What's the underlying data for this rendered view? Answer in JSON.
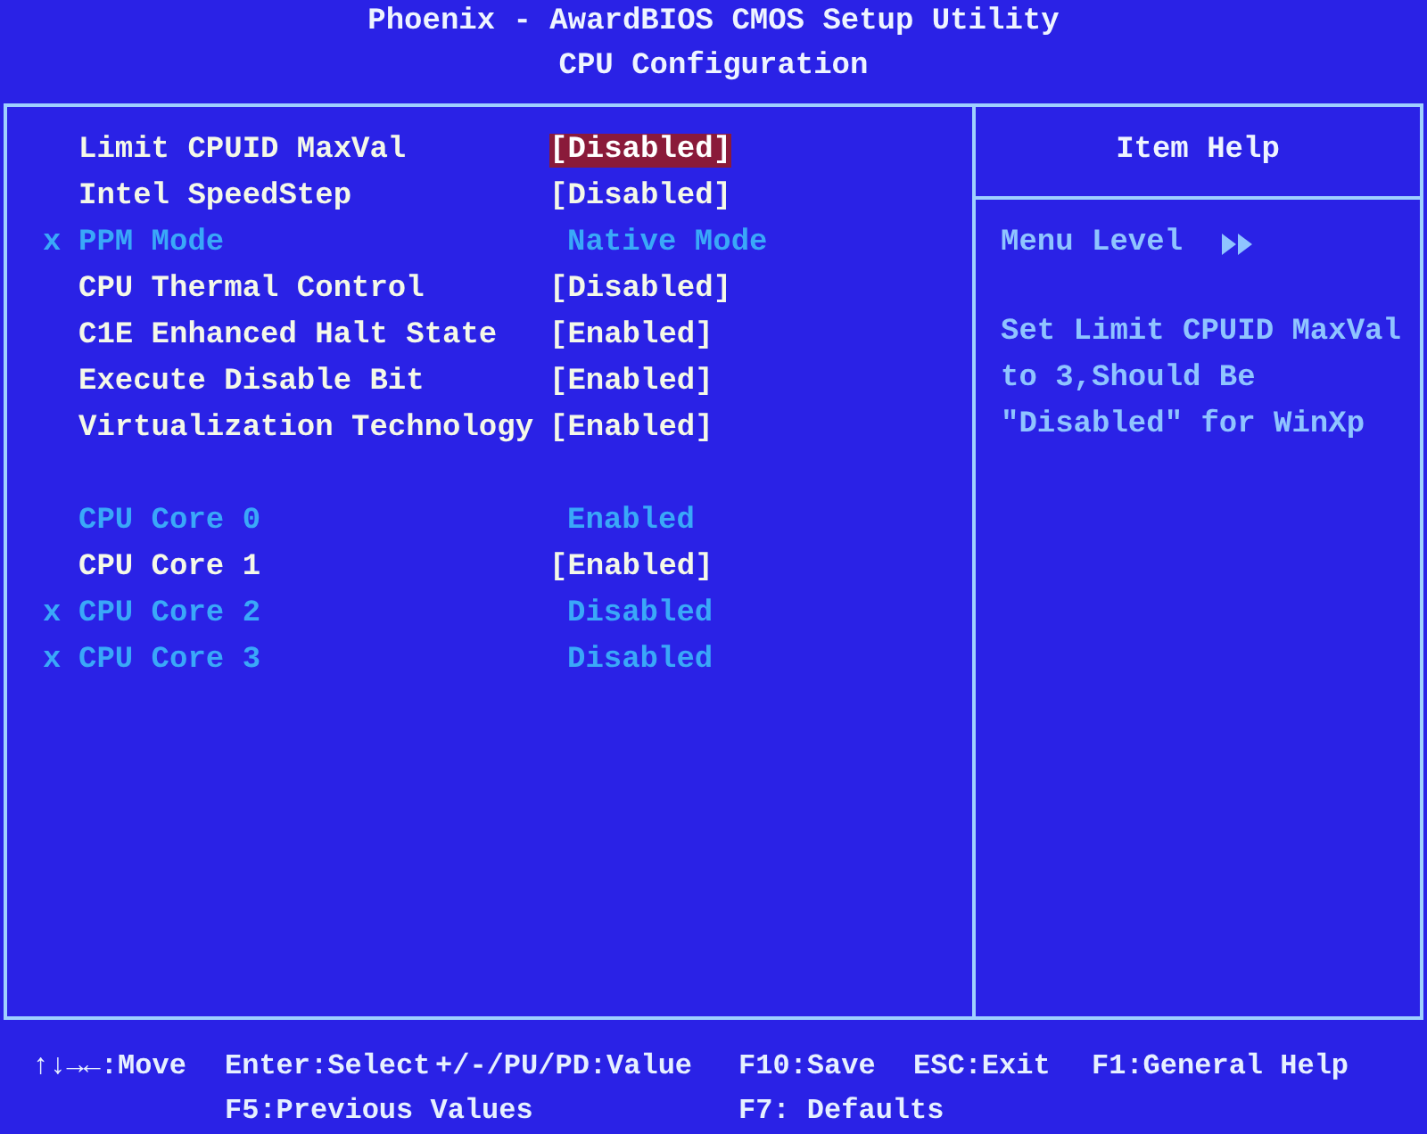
{
  "header": {
    "title": "Phoenix - AwardBIOS CMOS Setup Utility",
    "subtitle": "CPU Configuration"
  },
  "groups": [
    {
      "items": [
        {
          "label": "Limit CPUID MaxVal",
          "value": "[Disabled]",
          "selected": true,
          "disabled": false
        },
        {
          "label": "Intel SpeedStep",
          "value": "[Disabled]",
          "selected": false,
          "disabled": false
        },
        {
          "marker": "x",
          "label": "PPM Mode",
          "value": "Native Mode",
          "selected": false,
          "disabled": true
        },
        {
          "label": "CPU Thermal Control",
          "value": "[Disabled]",
          "selected": false,
          "disabled": false
        },
        {
          "label": "C1E Enhanced Halt State",
          "value": "[Enabled]",
          "selected": false,
          "disabled": false
        },
        {
          "label": "Execute Disable Bit",
          "value": "[Enabled]",
          "selected": false,
          "disabled": false
        },
        {
          "label": "Virtualization Technology",
          "value": "[Enabled]",
          "selected": false,
          "disabled": false
        }
      ]
    },
    {
      "items": [
        {
          "label": "CPU Core 0",
          "value": "Enabled",
          "selected": false,
          "disabled": true
        },
        {
          "label": "CPU Core 1",
          "value": "[Enabled]",
          "selected": false,
          "disabled": false
        },
        {
          "marker": "x",
          "label": "CPU Core 2",
          "value": "Disabled",
          "selected": false,
          "disabled": true
        },
        {
          "marker": "x",
          "label": "CPU Core 3",
          "value": "Disabled",
          "selected": false,
          "disabled": true
        }
      ]
    }
  ],
  "help": {
    "title": "Item Help",
    "menu_level": "Menu Level",
    "text": [
      "Set Limit CPUID MaxVal",
      "to 3,Should Be",
      "\"Disabled\" for WinXp"
    ]
  },
  "footer": [
    [
      "↑↓→←:Move",
      "Enter:Select",
      "+/-/PU/PD:Value",
      "F10:Save",
      "ESC:Exit",
      "F1:General Help"
    ],
    [
      "F5:Previous Values",
      "F7: Defaults"
    ]
  ]
}
